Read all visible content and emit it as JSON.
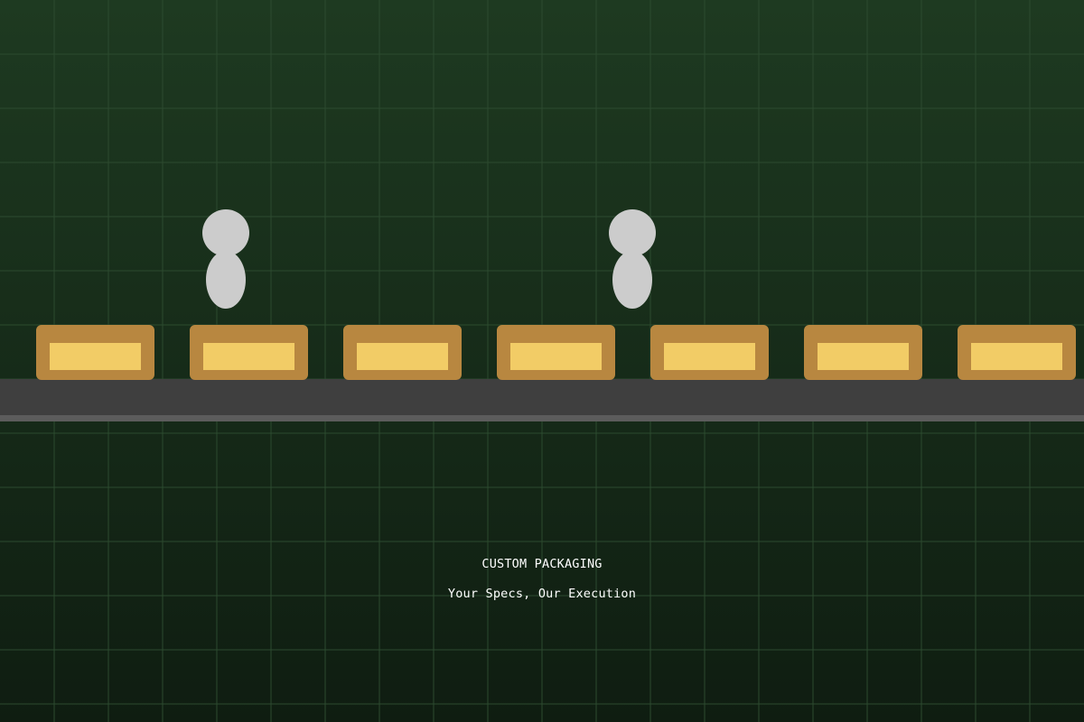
{
  "colors": {
    "background_top": "#1e3a21",
    "background_bottom": "#0f1d11",
    "grid_line": "#2c4a2f",
    "belt": "#3f3f3f",
    "belt_edge": "#5c5c5c",
    "box_outer": "#b88740",
    "box_inner": "#f2cc66",
    "figure": "#cccccc",
    "caption_text": "#ffffff"
  },
  "scene": {
    "box_count": 7,
    "figure_count": 2,
    "icons": [
      "package-box-icon",
      "bottle-figure-icon"
    ]
  },
  "caption": {
    "title": "CUSTOM PACKAGING",
    "subtitle": "Your Specs, Our Execution"
  }
}
